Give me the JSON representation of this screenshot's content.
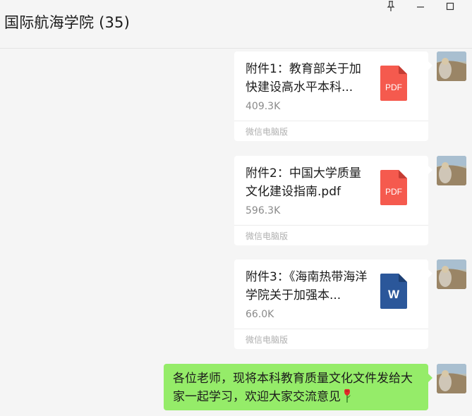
{
  "window": {
    "title": "国际航海学院 (35)",
    "controls": [
      "pin-icon",
      "minimize-icon",
      "maximize-icon"
    ]
  },
  "messages": [
    {
      "type": "file",
      "name": "附件1：教育部关于加快建设高水平本科...",
      "size": "409.3K",
      "source": "微信电脑版",
      "icon": "pdf-icon",
      "icon_label": "PDF",
      "icon_color": "#f55a4e"
    },
    {
      "type": "file",
      "name": "附件2：中国大学质量文化建设指南.pdf",
      "size": "596.3K",
      "source": "微信电脑版",
      "icon": "pdf-icon",
      "icon_label": "PDF",
      "icon_color": "#f55a4e"
    },
    {
      "type": "file",
      "name": "附件3：《海南热带海洋学院关于加强本...",
      "size": "66.0K",
      "source": "微信电脑版",
      "icon": "word-icon",
      "icon_label": "W",
      "icon_color": "#2b579a"
    },
    {
      "type": "text",
      "text": "各位老师，现将本科教育质量文化文件发给大家一起学习，欢迎大家交流意见",
      "emoji": "rose-icon"
    }
  ],
  "colors": {
    "sent_bubble": "#95ec69",
    "file_bubble": "#ffffff",
    "background": "#f5f5f5"
  }
}
